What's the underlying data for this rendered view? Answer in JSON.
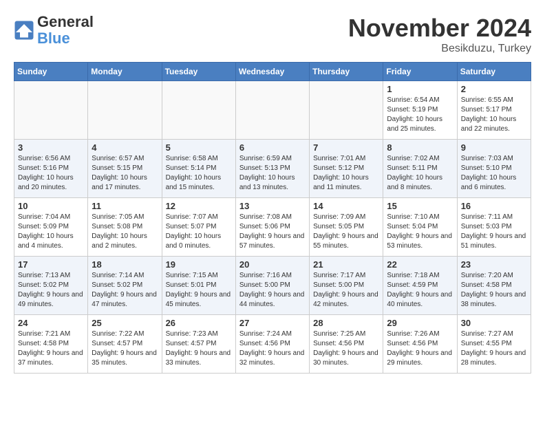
{
  "header": {
    "logo_line1": "General",
    "logo_line2": "Blue",
    "month": "November 2024",
    "location": "Besikduzu, Turkey"
  },
  "weekdays": [
    "Sunday",
    "Monday",
    "Tuesday",
    "Wednesday",
    "Thursday",
    "Friday",
    "Saturday"
  ],
  "weeks": [
    [
      {
        "day": "",
        "info": ""
      },
      {
        "day": "",
        "info": ""
      },
      {
        "day": "",
        "info": ""
      },
      {
        "day": "",
        "info": ""
      },
      {
        "day": "",
        "info": ""
      },
      {
        "day": "1",
        "info": "Sunrise: 6:54 AM\nSunset: 5:19 PM\nDaylight: 10 hours and 25 minutes."
      },
      {
        "day": "2",
        "info": "Sunrise: 6:55 AM\nSunset: 5:17 PM\nDaylight: 10 hours and 22 minutes."
      }
    ],
    [
      {
        "day": "3",
        "info": "Sunrise: 6:56 AM\nSunset: 5:16 PM\nDaylight: 10 hours and 20 minutes."
      },
      {
        "day": "4",
        "info": "Sunrise: 6:57 AM\nSunset: 5:15 PM\nDaylight: 10 hours and 17 minutes."
      },
      {
        "day": "5",
        "info": "Sunrise: 6:58 AM\nSunset: 5:14 PM\nDaylight: 10 hours and 15 minutes."
      },
      {
        "day": "6",
        "info": "Sunrise: 6:59 AM\nSunset: 5:13 PM\nDaylight: 10 hours and 13 minutes."
      },
      {
        "day": "7",
        "info": "Sunrise: 7:01 AM\nSunset: 5:12 PM\nDaylight: 10 hours and 11 minutes."
      },
      {
        "day": "8",
        "info": "Sunrise: 7:02 AM\nSunset: 5:11 PM\nDaylight: 10 hours and 8 minutes."
      },
      {
        "day": "9",
        "info": "Sunrise: 7:03 AM\nSunset: 5:10 PM\nDaylight: 10 hours and 6 minutes."
      }
    ],
    [
      {
        "day": "10",
        "info": "Sunrise: 7:04 AM\nSunset: 5:09 PM\nDaylight: 10 hours and 4 minutes."
      },
      {
        "day": "11",
        "info": "Sunrise: 7:05 AM\nSunset: 5:08 PM\nDaylight: 10 hours and 2 minutes."
      },
      {
        "day": "12",
        "info": "Sunrise: 7:07 AM\nSunset: 5:07 PM\nDaylight: 10 hours and 0 minutes."
      },
      {
        "day": "13",
        "info": "Sunrise: 7:08 AM\nSunset: 5:06 PM\nDaylight: 9 hours and 57 minutes."
      },
      {
        "day": "14",
        "info": "Sunrise: 7:09 AM\nSunset: 5:05 PM\nDaylight: 9 hours and 55 minutes."
      },
      {
        "day": "15",
        "info": "Sunrise: 7:10 AM\nSunset: 5:04 PM\nDaylight: 9 hours and 53 minutes."
      },
      {
        "day": "16",
        "info": "Sunrise: 7:11 AM\nSunset: 5:03 PM\nDaylight: 9 hours and 51 minutes."
      }
    ],
    [
      {
        "day": "17",
        "info": "Sunrise: 7:13 AM\nSunset: 5:02 PM\nDaylight: 9 hours and 49 minutes."
      },
      {
        "day": "18",
        "info": "Sunrise: 7:14 AM\nSunset: 5:02 PM\nDaylight: 9 hours and 47 minutes."
      },
      {
        "day": "19",
        "info": "Sunrise: 7:15 AM\nSunset: 5:01 PM\nDaylight: 9 hours and 45 minutes."
      },
      {
        "day": "20",
        "info": "Sunrise: 7:16 AM\nSunset: 5:00 PM\nDaylight: 9 hours and 44 minutes."
      },
      {
        "day": "21",
        "info": "Sunrise: 7:17 AM\nSunset: 5:00 PM\nDaylight: 9 hours and 42 minutes."
      },
      {
        "day": "22",
        "info": "Sunrise: 7:18 AM\nSunset: 4:59 PM\nDaylight: 9 hours and 40 minutes."
      },
      {
        "day": "23",
        "info": "Sunrise: 7:20 AM\nSunset: 4:58 PM\nDaylight: 9 hours and 38 minutes."
      }
    ],
    [
      {
        "day": "24",
        "info": "Sunrise: 7:21 AM\nSunset: 4:58 PM\nDaylight: 9 hours and 37 minutes."
      },
      {
        "day": "25",
        "info": "Sunrise: 7:22 AM\nSunset: 4:57 PM\nDaylight: 9 hours and 35 minutes."
      },
      {
        "day": "26",
        "info": "Sunrise: 7:23 AM\nSunset: 4:57 PM\nDaylight: 9 hours and 33 minutes."
      },
      {
        "day": "27",
        "info": "Sunrise: 7:24 AM\nSunset: 4:56 PM\nDaylight: 9 hours and 32 minutes."
      },
      {
        "day": "28",
        "info": "Sunrise: 7:25 AM\nSunset: 4:56 PM\nDaylight: 9 hours and 30 minutes."
      },
      {
        "day": "29",
        "info": "Sunrise: 7:26 AM\nSunset: 4:56 PM\nDaylight: 9 hours and 29 minutes."
      },
      {
        "day": "30",
        "info": "Sunrise: 7:27 AM\nSunset: 4:55 PM\nDaylight: 9 hours and 28 minutes."
      }
    ]
  ]
}
